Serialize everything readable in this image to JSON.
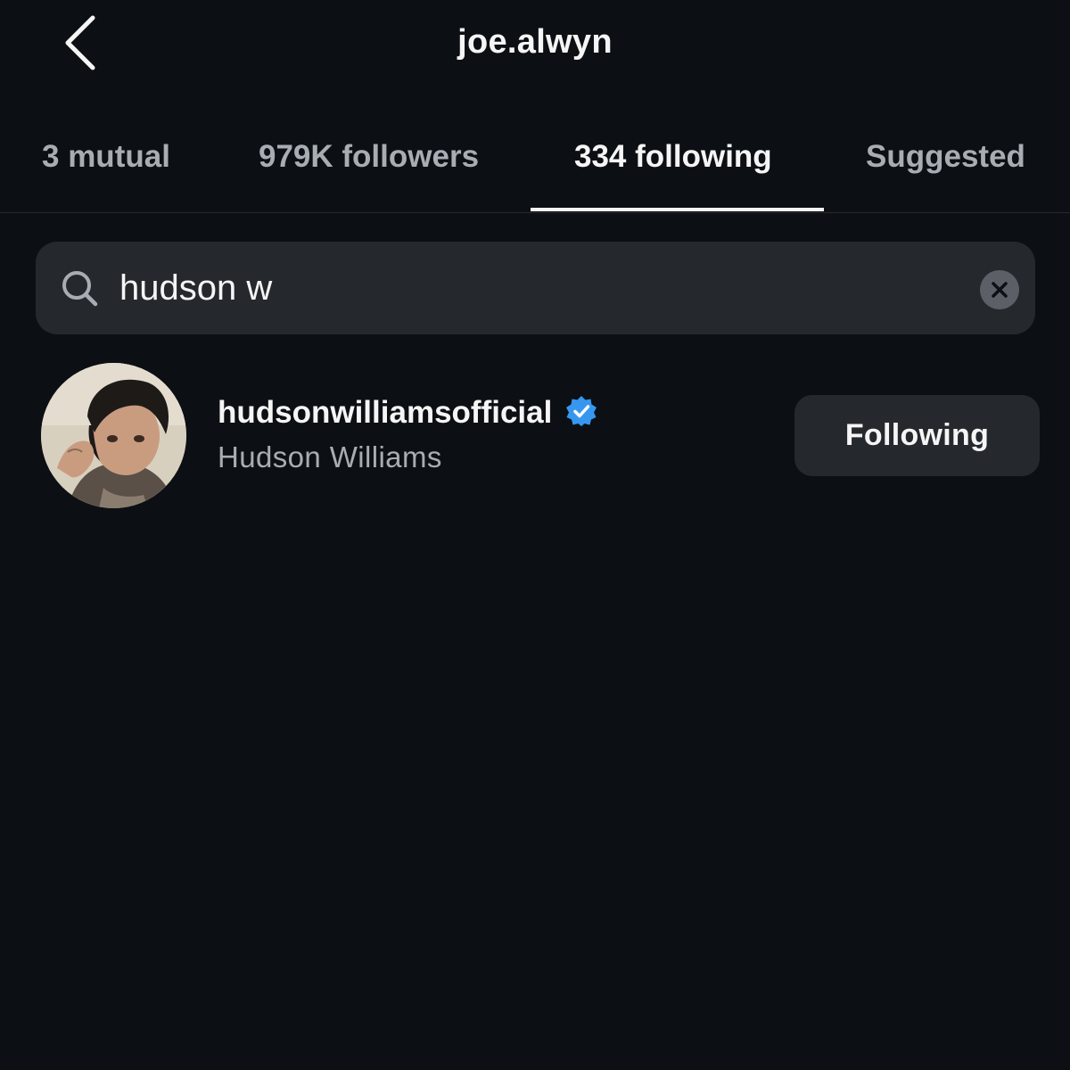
{
  "header": {
    "title": "joe.alwyn",
    "back_icon": "chevron-left-icon"
  },
  "tabs": [
    {
      "label": "3 mutual",
      "active": false
    },
    {
      "label": "979K followers",
      "active": false
    },
    {
      "label": "334 following",
      "active": true
    },
    {
      "label": "Suggested",
      "active": false
    }
  ],
  "search": {
    "value": "hudson w",
    "search_icon": "search-icon",
    "clear_icon": "clear-icon"
  },
  "results": [
    {
      "username": "hudsonwilliamsofficial",
      "full_name": "Hudson Williams",
      "verified": true,
      "button_label": "Following"
    }
  ],
  "colors": {
    "background": "#0c1014",
    "surface": "#25292e",
    "text_primary": "#f5f5f5",
    "text_secondary": "#a8adb3",
    "verified_blue": "#3797f0"
  }
}
